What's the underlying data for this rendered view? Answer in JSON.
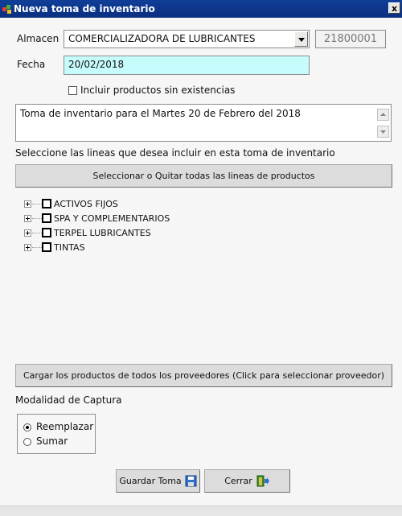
{
  "window": {
    "title": "Nueva toma de inventario",
    "close_label": "x"
  },
  "almacen": {
    "label": "Almacen",
    "value": "COMERCIALIZADORA DE LUBRICANTES",
    "code": "21800001"
  },
  "fecha": {
    "label": "Fecha",
    "value": "20/02/2018"
  },
  "incluir_sin_existencias": {
    "label": "Incluir productos sin existencias",
    "checked": false
  },
  "description": {
    "value": "Toma de inventario para el Martes 20 de Febrero del 2018"
  },
  "lines": {
    "instruction": "Seleccione las lineas que desea incluir en esta toma de inventario",
    "toggle_all_label": "Seleccionar o Quitar todas las lineas de productos",
    "items": [
      {
        "label": "ACTIVOS FIJOS",
        "checked": false
      },
      {
        "label": "SPA Y COMPLEMENTARIOS",
        "checked": false
      },
      {
        "label": "TERPEL LUBRICANTES",
        "checked": false
      },
      {
        "label": "TINTAS",
        "checked": false
      }
    ]
  },
  "cargar_label": "Cargar los productos de todos los proveedores (Click para seleccionar proveedor)",
  "modalidad": {
    "label": "Modalidad de Captura",
    "options": [
      {
        "label": "Reemplazar",
        "selected": true
      },
      {
        "label": "Sumar",
        "selected": false
      }
    ]
  },
  "buttons": {
    "guardar": "Guardar Toma",
    "cerrar": "Cerrar"
  },
  "colors": {
    "title_bar": "#0a2f80",
    "date_field_bg": "#c6fcfc"
  }
}
